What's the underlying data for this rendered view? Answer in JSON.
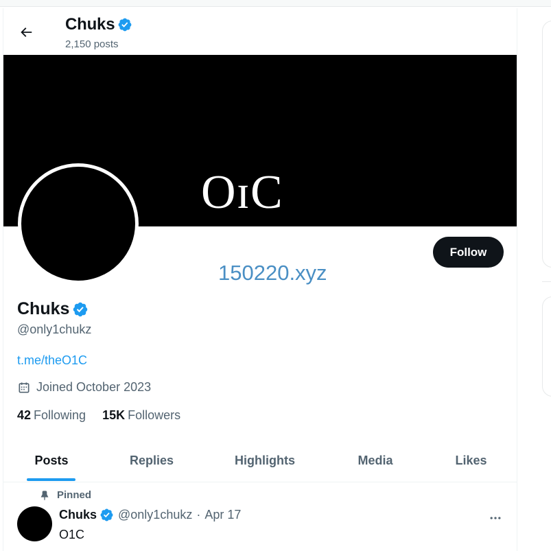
{
  "header": {
    "name": "Chuks",
    "posts_count": "2,150 posts"
  },
  "banner": {
    "logo_text": "OɪC"
  },
  "overlay": {
    "watermark": "150220.xyz"
  },
  "profile": {
    "follow_label": "Follow",
    "name": "Chuks",
    "handle": "@only1chukz",
    "link": "t.me/theO1C",
    "joined": "Joined October 2023",
    "following_count": "42",
    "following_label": "Following",
    "followers_count": "15K",
    "followers_label": "Followers"
  },
  "tabs": [
    {
      "label": "Posts"
    },
    {
      "label": "Replies"
    },
    {
      "label": "Highlights"
    },
    {
      "label": "Media"
    },
    {
      "label": "Likes"
    }
  ],
  "pinned_post": {
    "pinned_label": "Pinned",
    "name": "Chuks",
    "handle": "@only1chukz",
    "separator": "·",
    "date": "Apr 17",
    "text": "O1C"
  },
  "colors": {
    "accent": "#1d9bf0",
    "text_primary": "#0f1419",
    "text_secondary": "#536471",
    "follow_button": "#0f1419"
  },
  "icons": {
    "back": "arrow-left-icon",
    "verified": "verified-badge-icon",
    "calendar": "calendar-icon",
    "pin": "pin-icon",
    "more": "more-horizontal-icon"
  }
}
